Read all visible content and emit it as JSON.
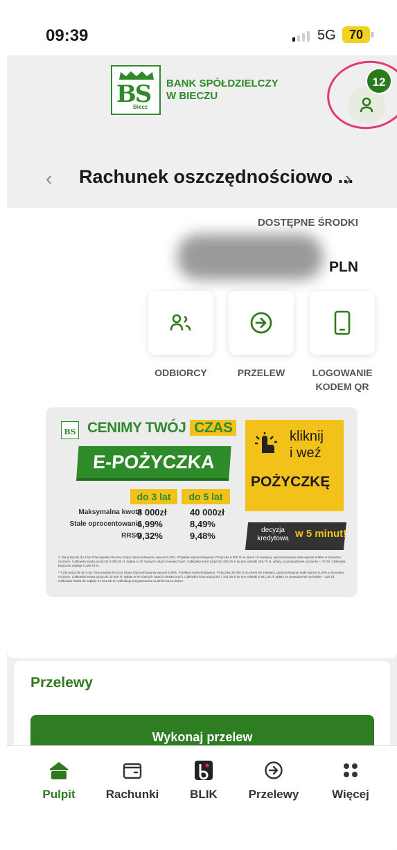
{
  "status_bar": {
    "time": "09:39",
    "network": "5G",
    "battery": "70"
  },
  "header": {
    "bank_name_line1": "BANK SPÓŁDZIELCZY",
    "bank_name_line2": "W BIECZU",
    "logo_letters": "BS",
    "logo_subtext": "Biecz",
    "notifications_count": "12"
  },
  "account": {
    "name": "Rachunek oszczędnościowo ...",
    "available_label": "DOSTĘPNE ŚRODKI",
    "currency": "PLN"
  },
  "quick_actions": [
    {
      "label": "ODBIORCY",
      "icon": "recipients-icon"
    },
    {
      "label": "PRZELEW",
      "icon": "transfer-arrow-icon"
    },
    {
      "label_line1": "LOGOWANIE",
      "label_line2": "KODEM QR",
      "icon": "phone-icon"
    }
  ],
  "banner": {
    "headline": "CENIMY TWÓJ",
    "headline_highlight": "CZAS",
    "product": "E-POŻYCZKA",
    "cta_line1": "kliknij",
    "cta_line2": "i weź",
    "cta_line3": "POŻYCZKĘ",
    "col1_header": "do 3 lat",
    "col2_header": "do 5 lat",
    "rows": [
      {
        "label": "Maksymalna kwota",
        "v1": "8 000zł",
        "v2": "40 000zł"
      },
      {
        "label": "Stałe oprocentowanie",
        "v1": "6,99%",
        "v2": "8,49%"
      },
      {
        "label": "RRSO",
        "v1": "9,32%",
        "v2": "9,48%"
      }
    ],
    "decision_text": "decyzja kredytowa",
    "decision_time": "w 5 minut!",
    "fine_print_1": "*) Dla pożyczki do 3 lat: Rzeczywista Roczna Stopa Oprocentowania wynosi 9,32%. Przykład reprezentatywny: Pożyczka 8 000 zł na okres 10 miesięcy, oprocentowanie stałe wynosi 6,99% w stosunku rocznym. Całkowita kwota pożyczki 8 000,00 zł. Spłata w 10 równych ratach miesięcznych. Całkowity koszt pożyczki 328,76 zł (w tym odsetki 258,76 zł, opłaty za prowadzenie rachunku – 70 zł). Całkowita kwota do zapłaty 8 328,76 zł.",
    "fine_print_2": "**) Dla pożyczki do 5 lat: Rzeczywista Roczna Stopa Oprocentowania wynosi 9,48%. Przykład reprezentatywny: Pożyczka 30 000 zł na okres 60 miesięcy, oprocentowanie stałe wynosi 8,49% w stosunku rocznym. Całkowita kwota pożyczki 30 000 zł. Spłata w 60 równych ratach miesięcznych. Całkowity koszt pożyczki 7 341,05 zł (w tym odsetki 6 921,05 zł, opłaty za prowadzenie rachunku – 420 zł). Całkowita kwota do zapłaty 37 341,05 zł. Kalkulacja przygotowana na dzień 03.12.2025 r."
  },
  "transfers_card": {
    "title": "Przelewy",
    "button": "Wykonaj przelew"
  },
  "bottom_nav": [
    {
      "label": "Pulpit",
      "icon": "home-icon",
      "active": true
    },
    {
      "label": "Rachunki",
      "icon": "wallet-icon"
    },
    {
      "label": "BLIK",
      "icon": "blik-icon"
    },
    {
      "label": "Przelewy",
      "icon": "transfer-arrow-icon"
    },
    {
      "label": "Więcej",
      "icon": "more-dots-icon"
    }
  ],
  "colors": {
    "brand_green": "#2f7a1f",
    "accent_yellow": "#f3c21a",
    "highlight": "#e23a6e"
  }
}
